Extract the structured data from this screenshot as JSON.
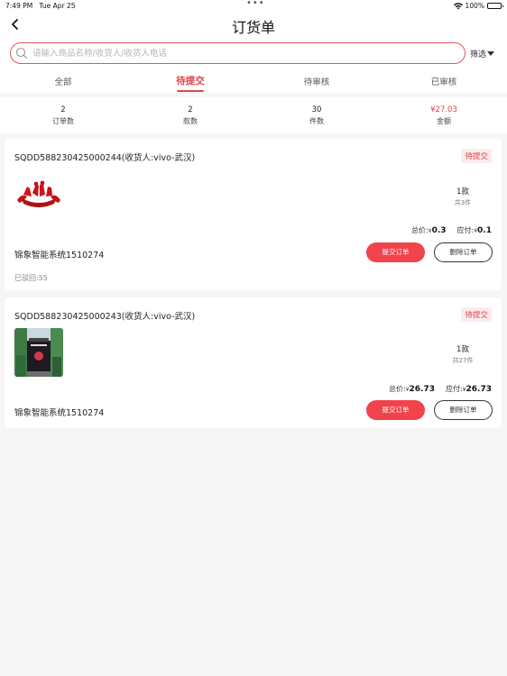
{
  "status_bar": {
    "time": "7:49 PM",
    "date": "Tue Apr 25",
    "dots": "•••",
    "battery": "100%"
  },
  "nav": {
    "title": "订货单",
    "back_icon": "chevron-left-icon"
  },
  "search": {
    "placeholder": "请输入商品名称/收货人/收货人电话",
    "value": "",
    "filter_label": "筛选"
  },
  "tabs": [
    {
      "label": "全部",
      "active": false
    },
    {
      "label": "待提交",
      "active": true
    },
    {
      "label": "待审核",
      "active": false
    },
    {
      "label": "已审核",
      "active": false
    }
  ],
  "summary": [
    {
      "value": "2",
      "label": "订单数"
    },
    {
      "value": "2",
      "label": "款数"
    },
    {
      "value": "30",
      "label": "件数"
    },
    {
      "value": "¥27.03",
      "label": "金额"
    }
  ],
  "accent_color": "#e5414a",
  "orders": [
    {
      "order_no": "SQDD588230425000244(收货人:vivo-武汉)",
      "status": "待提交",
      "styles": "1款",
      "pieces": "共3件",
      "total_label": "总价:",
      "total_currency": "¥",
      "total_value": "0.3",
      "payable_label": "应付:",
      "payable_currency": "¥",
      "payable_value": "0.1",
      "store": "锦象智能系统1510274",
      "submit_label": "提交订单",
      "delete_label": "删除订单",
      "rejected": "已驳回:55"
    },
    {
      "order_no": "SQDD588230425000243(收货人:vivo-武汉)",
      "status": "待提交",
      "styles": "1款",
      "pieces": "共27件",
      "total_label": "总价:",
      "total_currency": "¥",
      "total_value": "26.73",
      "payable_label": "应付:",
      "payable_currency": "¥",
      "payable_value": "26.73",
      "store": "锦象智能系统1510274",
      "submit_label": "提交订单",
      "delete_label": "删除订单"
    }
  ]
}
